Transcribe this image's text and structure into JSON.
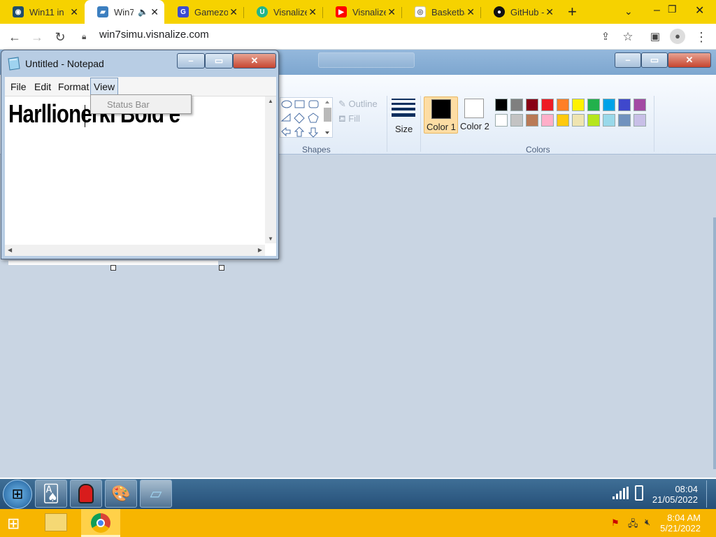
{
  "browser": {
    "tabs": [
      {
        "title": "Win11 in",
        "icon": "win11-favicon-icon"
      },
      {
        "title": "Win7",
        "icon": "win7-favicon-icon",
        "audio": true
      },
      {
        "title": "Gamezop",
        "icon": "gamezop-favicon-icon"
      },
      {
        "title": "Visnalize",
        "icon": "visnalize-favicon-icon"
      },
      {
        "title": "Visnalize",
        "icon": "youtube-favicon-icon"
      },
      {
        "title": "Basketba",
        "icon": "basketball-favicon-icon"
      },
      {
        "title": "GitHub -",
        "icon": "github-favicon-icon"
      }
    ],
    "url": "win7simu.visnalize.com"
  },
  "paint": {
    "ribbon": {
      "shapes_label": "Shapes",
      "outline_label": "Outline",
      "fill_label": "Fill",
      "size_label": "Size",
      "color1_label": "Color 1",
      "color2_label": "Color 2",
      "colors_label": "Colors",
      "color1": "#000000",
      "color2": "#ffffff",
      "palette_row1": [
        "#000000",
        "#7f7f7f",
        "#880015",
        "#ed1c24",
        "#ff7f27",
        "#fff200",
        "#22b14c",
        "#00a2e8",
        "#3f48cc",
        "#a349a4"
      ],
      "palette_row2": [
        "#ffffff",
        "#c3c3c3",
        "#b97a57",
        "#ffaec9",
        "#ffc90e",
        "#efe4b0",
        "#b5e61d",
        "#99d9ea",
        "#7092be",
        "#c8bfe7"
      ]
    }
  },
  "notepad": {
    "title": "Untitled - Notepad",
    "menu": [
      "File",
      "Edit",
      "Format",
      "View"
    ],
    "dropdown_item": "Status Bar",
    "text": "HarllionerkI Bold e"
  },
  "taskbar": {
    "time": "08:04",
    "date": "21/05/2022"
  },
  "host_taskbar": {
    "time": "8:04 AM",
    "date": "5/21/2022"
  }
}
